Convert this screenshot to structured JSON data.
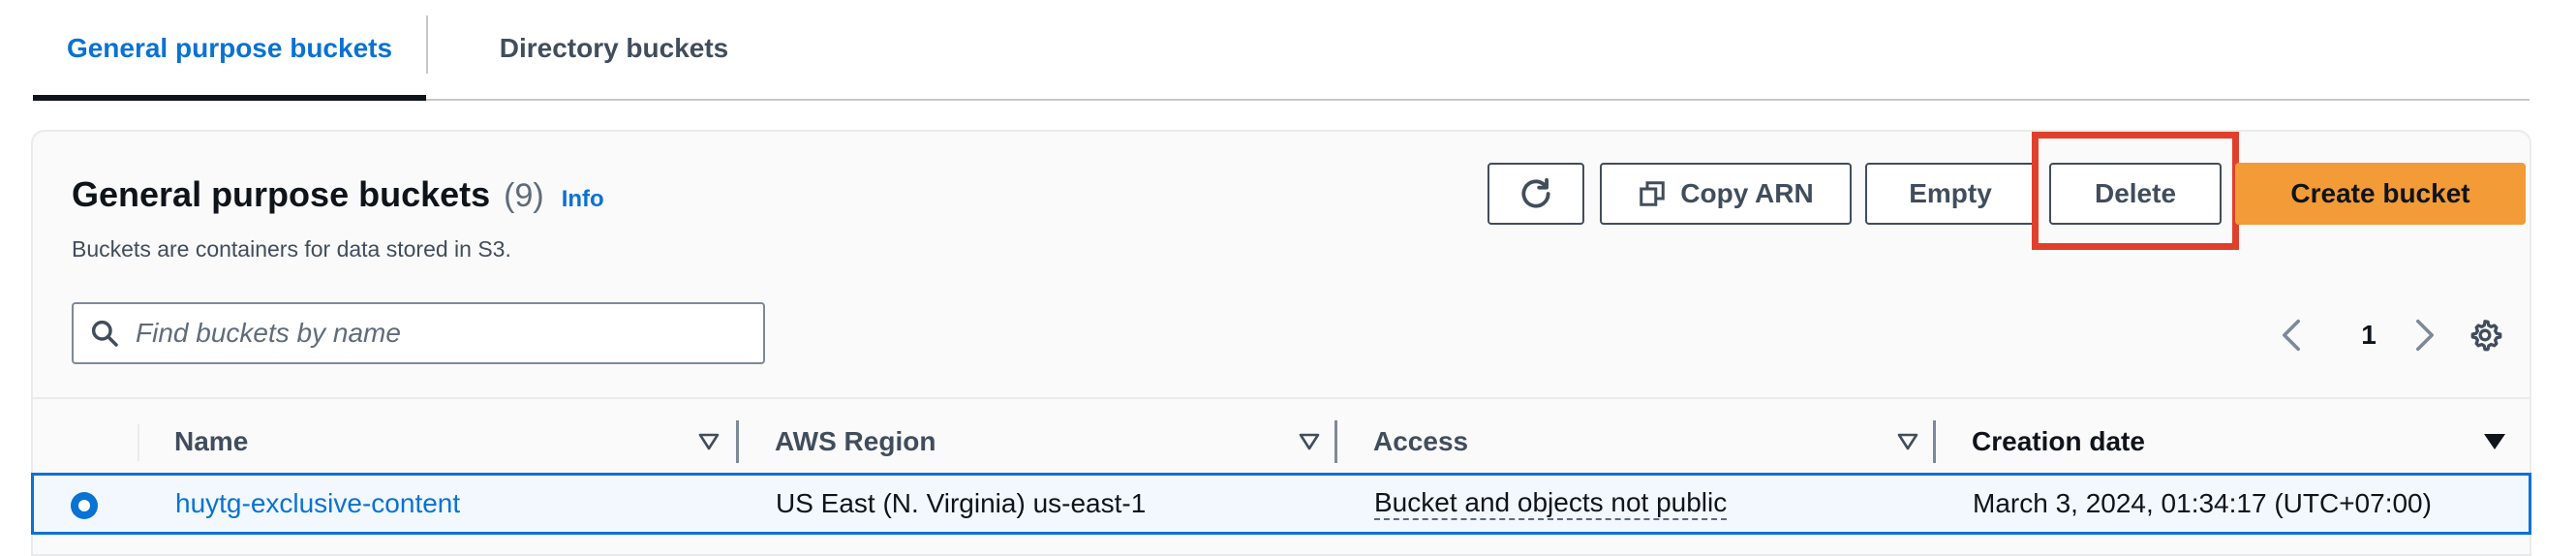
{
  "tabs": [
    {
      "label": "General purpose buckets",
      "active": true
    },
    {
      "label": "Directory buckets",
      "active": false
    }
  ],
  "header": {
    "title": "General purpose buckets",
    "count": "(9)",
    "info": "Info",
    "description": "Buckets are containers for data stored in S3."
  },
  "actions": {
    "refresh_icon": "refresh-icon",
    "copy_arn": "Copy ARN",
    "copy_icon": "copy-icon",
    "empty": "Empty",
    "delete": "Delete",
    "create": "Create bucket"
  },
  "search": {
    "placeholder": "Find buckets by name",
    "value": ""
  },
  "pagination": {
    "current_page": "1"
  },
  "table": {
    "columns": [
      "Name",
      "AWS Region",
      "Access",
      "Creation date"
    ],
    "rows": [
      {
        "name": "huytg-exclusive-content",
        "region": "US East (N. Virginia) us-east-1",
        "access": "Bucket and objects not public",
        "created": "March 3, 2024, 01:34:17 (UTC+07:00)",
        "selected": true
      }
    ]
  },
  "colors": {
    "link": "#0972d3",
    "primary_button": "#f29b37",
    "highlight": "#e0402b",
    "selected_row_bg": "#f2f8fd"
  }
}
